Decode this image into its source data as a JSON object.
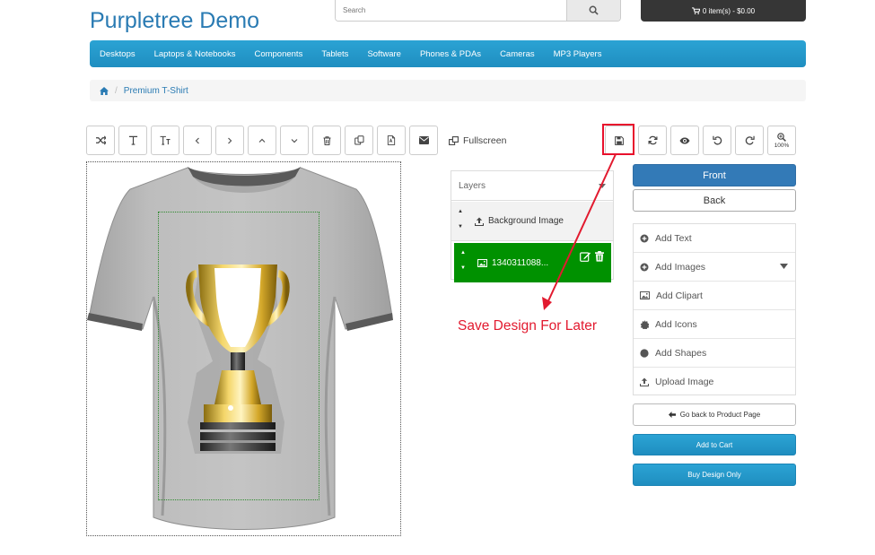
{
  "header": {
    "store_name": "Purpletree Demo",
    "search_placeholder": "Search",
    "cart_label": "0 item(s) - $0.00"
  },
  "menu": {
    "items": [
      "Desktops",
      "Laptops & Notebooks",
      "Components",
      "Tablets",
      "Software",
      "Phones & PDAs",
      "Cameras",
      "MP3 Players"
    ]
  },
  "breadcrumb": {
    "current": "Premium T-Shirt",
    "separator": "/"
  },
  "toolbar": {
    "left_icons": [
      "shuffle-icon",
      "text-icon",
      "text-size-icon",
      "chevron-left-icon",
      "chevron-right-icon",
      "chevron-up-icon",
      "chevron-down-icon",
      "trash-icon",
      "copy-icon",
      "pdf-icon",
      "envelope-icon"
    ],
    "fullscreen_label": "Fullscreen",
    "right_icons": [
      "save-icon",
      "refresh-icon",
      "eye-icon",
      "undo-icon",
      "redo-icon",
      "zoom-icon"
    ],
    "zoom_level": "100%"
  },
  "layers": {
    "title": "Layers",
    "items": [
      {
        "name": "Background Image",
        "active": false
      },
      {
        "name": "1340311088...",
        "active": true
      }
    ]
  },
  "annotation": {
    "text": "Save Design For Later",
    "color": "#e21a2f"
  },
  "sides": {
    "front_label": "Front",
    "back_label": "Back"
  },
  "tools": {
    "items": [
      "Add Text",
      "Add Images",
      "Add Clipart",
      "Add Icons",
      "Add Shapes",
      "Upload Image"
    ]
  },
  "actions": {
    "go_back_label": "Go back to Product Page",
    "add_to_cart_label": "Add to Cart",
    "buy_design_label": "Buy Design Only"
  },
  "colors": {
    "brand": "#2a7bb3",
    "menu": "#1f9bd0",
    "primary": "#337ab7",
    "active_layer": "#009100",
    "highlight": "#e8102c"
  }
}
